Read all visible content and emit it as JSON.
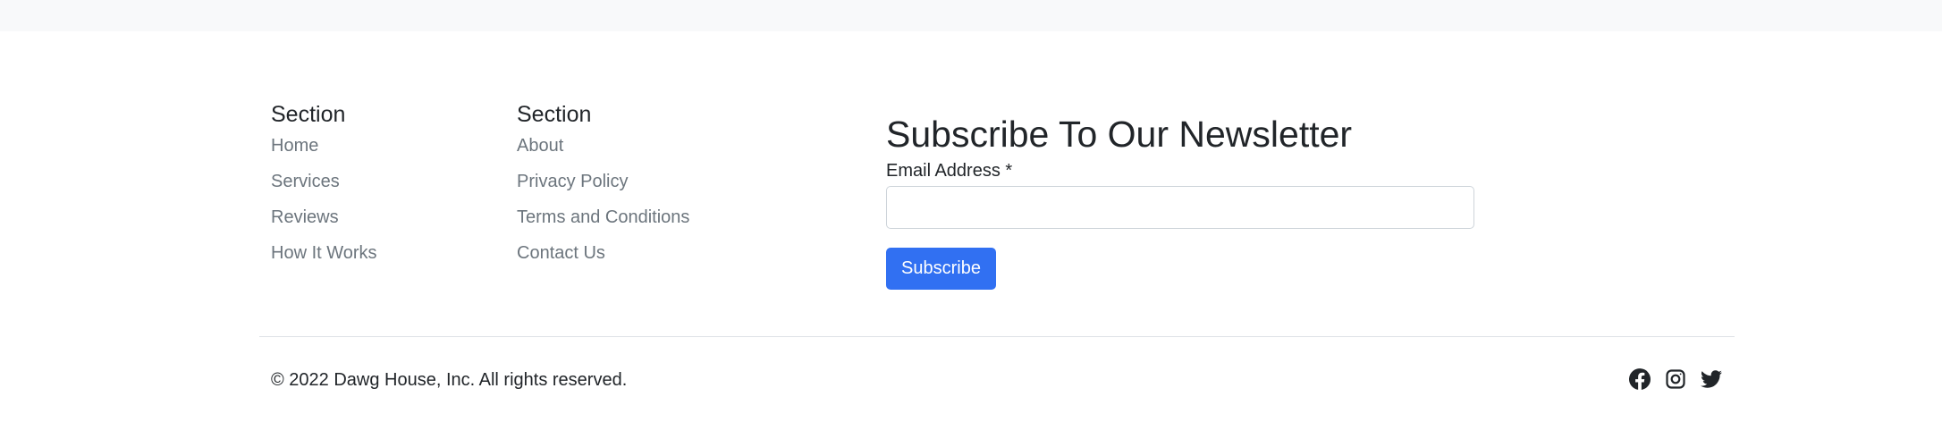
{
  "footer": {
    "columns": [
      {
        "heading": "Section",
        "links": [
          "Home",
          "Services",
          "Reviews",
          "How It Works"
        ]
      },
      {
        "heading": "Section",
        "links": [
          "About",
          "Privacy Policy",
          "Terms and Conditions",
          "Contact Us"
        ]
      }
    ],
    "newsletter": {
      "title": "Subscribe To Our Newsletter",
      "email_label": "Email Address *",
      "email_value": "",
      "email_placeholder": "",
      "button_label": "Subscribe"
    },
    "copyright": "© 2022 Dawg House, Inc. All rights reserved.",
    "social_icons": [
      "facebook-icon",
      "instagram-icon",
      "twitter-icon"
    ]
  },
  "colors": {
    "top_strip": "#f8f9fa",
    "link": "#6c757d",
    "text": "#212529",
    "accent": "#3170f2",
    "divider": "#dee2e6"
  }
}
